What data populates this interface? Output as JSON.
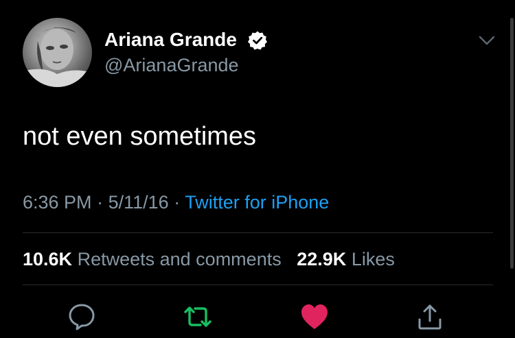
{
  "colors": {
    "background": "#000000",
    "text": "#ffffff",
    "secondary": "#8899a6",
    "link": "#1da1f2",
    "retweet_green": "#17bf63",
    "like_red": "#e0245e",
    "divider": "#2b2b2b"
  },
  "author": {
    "display_name": "Ariana Grande",
    "handle": "@ArianaGrande",
    "verified": true,
    "avatar_icon": "profile-photo"
  },
  "tweet": {
    "text": "not even sometimes",
    "time": "6:36 PM",
    "date": "5/11/16",
    "separator": "·",
    "source": "Twitter for iPhone"
  },
  "stats": {
    "retweets_count": "10.6K",
    "retweets_label": "Retweets and comments",
    "likes_count": "22.9K",
    "likes_label": "Likes"
  },
  "actions": [
    {
      "name": "reply",
      "icon": "speech-bubble-icon"
    },
    {
      "name": "retweet",
      "icon": "retweet-icon",
      "active": true
    },
    {
      "name": "like",
      "icon": "heart-icon",
      "active": true
    },
    {
      "name": "share",
      "icon": "share-icon"
    }
  ]
}
